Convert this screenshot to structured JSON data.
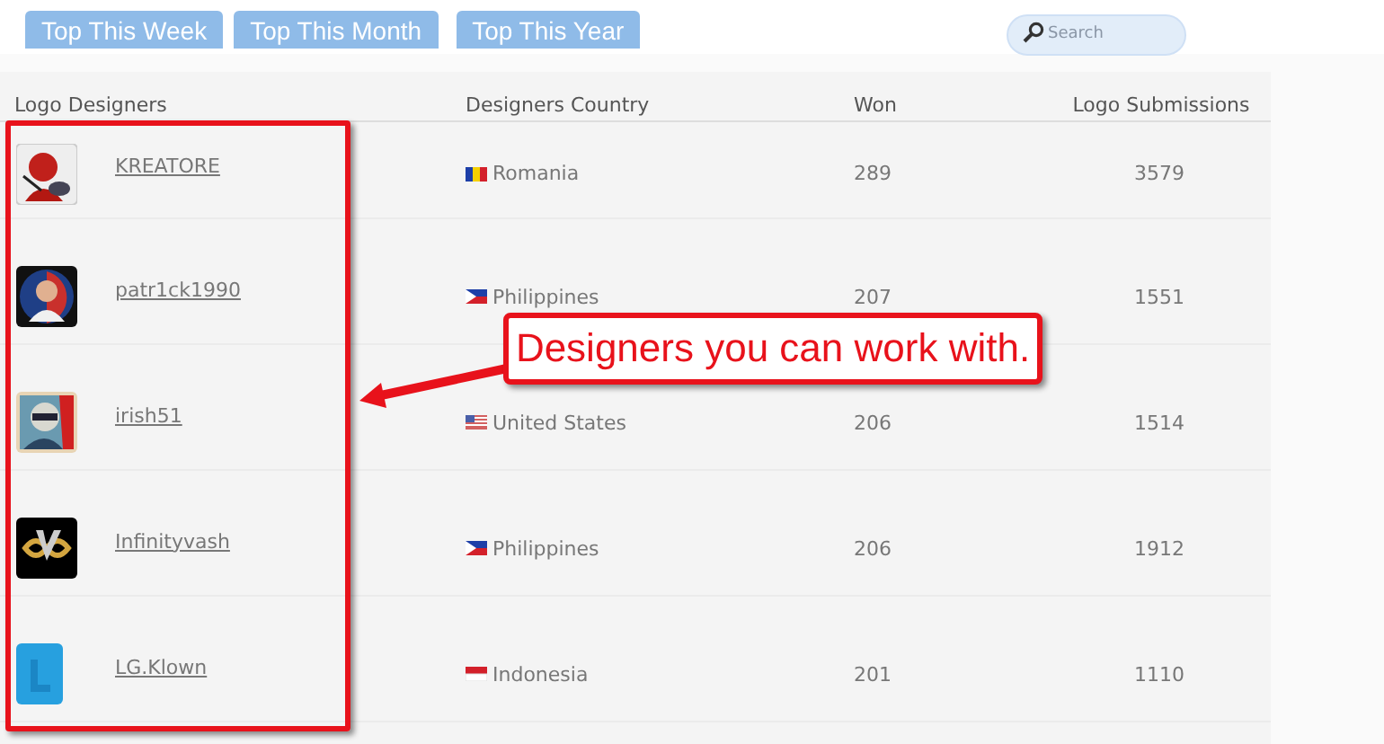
{
  "tabs": [
    {
      "label": "Top This Week",
      "selected": false
    },
    {
      "label": "Top This Month",
      "selected": false
    },
    {
      "label": "Top This Year",
      "selected": false
    }
  ],
  "search": {
    "placeholder": "Search"
  },
  "table": {
    "columns": [
      "Logo Designers",
      "Designers Country",
      "Won",
      "Logo Submissions"
    ],
    "rows": [
      {
        "designer": "KREATORE",
        "country": "Romania",
        "won": "289",
        "submissions": "3579"
      },
      {
        "designer": "patr1ck1990",
        "country": "Philippines",
        "won": "207",
        "submissions": "1551"
      },
      {
        "designer": "irish51",
        "country": "United States",
        "won": "206",
        "submissions": "1514"
      },
      {
        "designer": "Infinityvash",
        "country": "Philippines",
        "won": "206",
        "submissions": "1912"
      },
      {
        "designer": "LG.Klown",
        "country": "Indonesia",
        "won": "201",
        "submissions": "1110"
      }
    ]
  },
  "callout": {
    "text": "Designers you can work with."
  }
}
